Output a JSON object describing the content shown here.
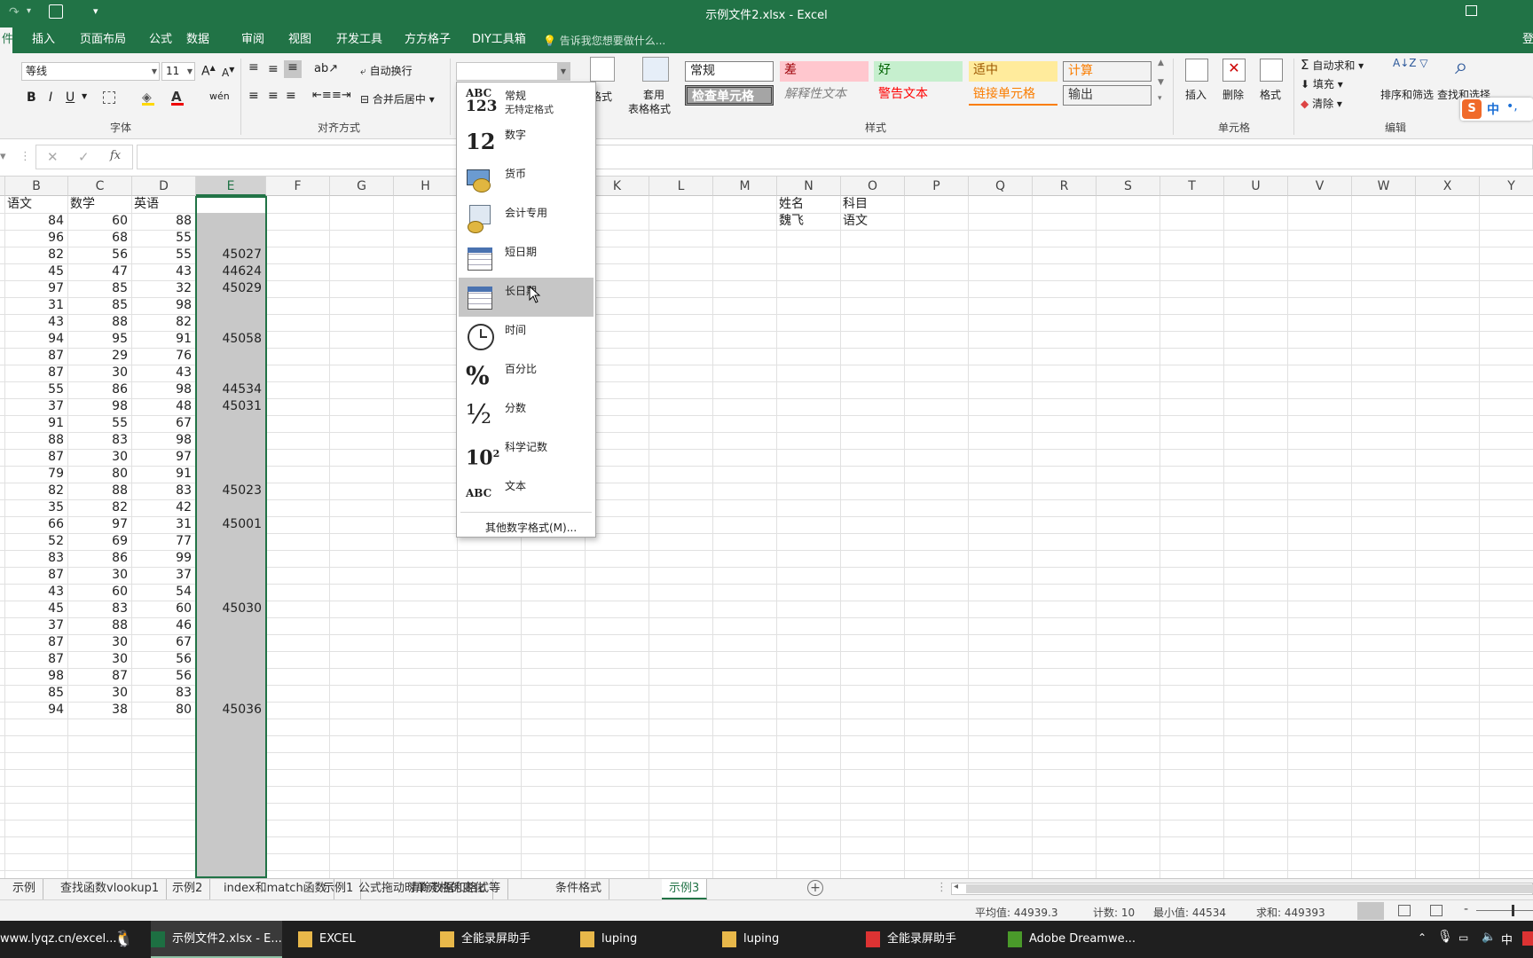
{
  "window": {
    "title": "示例文件2.xlsx - Excel"
  },
  "ribbon_tabs": [
    "插入",
    "页面布局",
    "公式",
    "数据",
    "审阅",
    "视图",
    "开发工具",
    "方方格子",
    "DIY工具箱"
  ],
  "tell_me": "告诉我您想要做什么...",
  "font": {
    "name": "等线",
    "size": "11"
  },
  "align": {
    "wrap": "自动换行",
    "merge": "合并后居中"
  },
  "groups": {
    "font": "字体",
    "align": "对齐方式",
    "styles": "样式",
    "cells": "单元格",
    "edit": "编辑"
  },
  "cond": {
    "line1": "件格式",
    "apply1": "套用",
    "apply2": "表格格式"
  },
  "styles": [
    {
      "label": "常规",
      "bg": "#ffffff",
      "fg": "#222222"
    },
    {
      "label": "差",
      "bg": "#ffc7ce",
      "fg": "#9c0006"
    },
    {
      "label": "好",
      "bg": "#c6efce",
      "fg": "#006100"
    },
    {
      "label": "适中",
      "bg": "#ffeb9c",
      "fg": "#9c5700"
    },
    {
      "label": "计算",
      "bg": "#f2f2f2",
      "fg": "#fa7d00"
    },
    {
      "label": "检查单元格",
      "bg": "#a5a5a5",
      "fg": "#ffffff"
    },
    {
      "label": "解释性文本",
      "bg": "#f3f3f3",
      "fg": "#7f7f7f"
    },
    {
      "label": "警告文本",
      "bg": "#f3f3f3",
      "fg": "#ff0000"
    },
    {
      "label": "链接单元格",
      "bg": "#f3f3f3",
      "fg": "#fa7d00"
    },
    {
      "label": "输出",
      "bg": "#f2f2f2",
      "fg": "#3f3f3f"
    }
  ],
  "cells_group": {
    "insert": "插入",
    "delete": "删除",
    "format": "格式"
  },
  "edit_group": {
    "autosum": "自动求和",
    "fill": "填充",
    "clear": "清除",
    "sort": "排序和筛选",
    "find": "查找和选择"
  },
  "columns": [
    "B",
    "C",
    "D",
    "E",
    "F",
    "G",
    "H",
    "I",
    "J",
    "K",
    "L",
    "M",
    "N",
    "O",
    "P",
    "Q",
    "R",
    "S",
    "T",
    "U",
    "V",
    "W",
    "X",
    "Y"
  ],
  "headers": {
    "B": "语文",
    "C": "数学",
    "D": "英语"
  },
  "side": {
    "n1": "姓名",
    "o1": "科目",
    "n2": "魏飞",
    "o2": "语文"
  },
  "rows": [
    [
      "84",
      "60",
      "88",
      ""
    ],
    [
      "96",
      "68",
      "55",
      ""
    ],
    [
      "82",
      "56",
      "55",
      "45027"
    ],
    [
      "45",
      "47",
      "43",
      "44624"
    ],
    [
      "97",
      "85",
      "32",
      "45029"
    ],
    [
      "31",
      "85",
      "98",
      ""
    ],
    [
      "43",
      "88",
      "82",
      ""
    ],
    [
      "94",
      "95",
      "91",
      "45058"
    ],
    [
      "87",
      "29",
      "76",
      ""
    ],
    [
      "87",
      "30",
      "43",
      ""
    ],
    [
      "55",
      "86",
      "98",
      "44534"
    ],
    [
      "37",
      "98",
      "48",
      "45031"
    ],
    [
      "91",
      "55",
      "67",
      ""
    ],
    [
      "88",
      "83",
      "98",
      ""
    ],
    [
      "87",
      "30",
      "97",
      ""
    ],
    [
      "79",
      "80",
      "91",
      ""
    ],
    [
      "82",
      "88",
      "83",
      "45023"
    ],
    [
      "35",
      "82",
      "42",
      ""
    ],
    [
      "66",
      "97",
      "31",
      "45001"
    ],
    [
      "52",
      "69",
      "77",
      ""
    ],
    [
      "83",
      "86",
      "99",
      ""
    ],
    [
      "87",
      "30",
      "37",
      ""
    ],
    [
      "43",
      "60",
      "54",
      ""
    ],
    [
      "45",
      "83",
      "60",
      "45030"
    ],
    [
      "37",
      "88",
      "46",
      ""
    ],
    [
      "87",
      "30",
      "67",
      ""
    ],
    [
      "87",
      "30",
      "56",
      ""
    ],
    [
      "98",
      "87",
      "56",
      ""
    ],
    [
      "85",
      "30",
      "83",
      ""
    ],
    [
      "94",
      "38",
      "80",
      "45036"
    ]
  ],
  "dropdown": {
    "items": [
      {
        "icon": "ABC123",
        "label": "常规",
        "sub": "无特定格式"
      },
      {
        "icon": "12",
        "label": "数字"
      },
      {
        "icon": "currency",
        "label": "货币"
      },
      {
        "icon": "accounting",
        "label": "会计专用"
      },
      {
        "icon": "calendar",
        "label": "短日期"
      },
      {
        "icon": "calendar",
        "label": "长日期"
      },
      {
        "icon": "clock",
        "label": "时间"
      },
      {
        "icon": "%",
        "label": "百分比"
      },
      {
        "icon": "½",
        "label": "分数"
      },
      {
        "icon": "10²",
        "label": "科学记数"
      },
      {
        "icon": "ABC",
        "label": "文本"
      }
    ],
    "more": "其他数字格式(M)..."
  },
  "sheet_tabs": [
    "示例",
    "查找函数vlookup1",
    "示例2",
    "index和match函数",
    "示例1",
    "公式拖动时单元格的变化",
    "清除数据和格式等",
    "条件格式",
    "示例3"
  ],
  "status": {
    "avg": "平均值: 44939.3",
    "count": "计数: 10",
    "min": "最小值: 44534",
    "sum": "求和: 449393"
  },
  "taskbar": [
    "www.lyqz.cn/excel...",
    "示例文件2.xlsx - E...",
    "EXCEL",
    "全能录屏助手",
    "luping",
    "luping",
    "全能录屏助手",
    "Adobe Dreamwe..."
  ],
  "tray": {
    "ime": "中"
  },
  "ime_bar": "中",
  "selected_fill": "#c8c8c8",
  "accent": "#217346"
}
